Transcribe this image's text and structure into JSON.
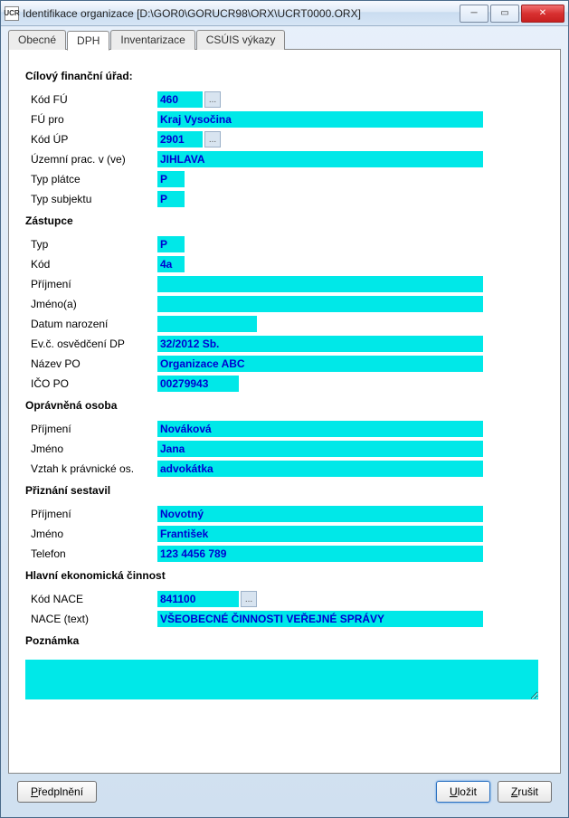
{
  "window": {
    "icon_text": "UCR",
    "title": "Identifikace organizace [D:\\GOR0\\GORUCR98\\ORX\\UCRT0000.ORX]"
  },
  "tabs": {
    "obecne": "Obecné",
    "dph": "DPH",
    "inventarizace": "Inventarizace",
    "csuis": "CSÚIS výkazy"
  },
  "sections": {
    "cilovy": "Cílový finanční úřad:",
    "zastupce": "Zástupce",
    "opravnena": "Oprávněná osoba",
    "priznani": "Přiznání sestavil",
    "hlavni": "Hlavní ekonomická činnost",
    "poznamka": "Poznámka"
  },
  "labels": {
    "kod_fu": "Kód FÚ",
    "fu_pro": "FÚ pro",
    "kod_up": "Kód ÚP",
    "uzemni": "Územní prac. v (ve)",
    "typ_platce": "Typ plátce",
    "typ_subjektu": "Typ subjektu",
    "z_typ": "Typ",
    "z_kod": "Kód",
    "z_prijmeni": "Příjmení",
    "z_jmenoa": "Jméno(a)",
    "z_datum": "Datum narození",
    "z_evc": "Ev.č. osvědčení DP",
    "z_nazev": "Název PO",
    "z_ico": "IČO PO",
    "o_prijmeni": "Příjmení",
    "o_jmeno": "Jméno",
    "o_vztah": "Vztah k právnické os.",
    "p_prijmeni": "Příjmení",
    "p_jmeno": "Jméno",
    "p_telefon": "Telefon",
    "kod_nace": "Kód NACE",
    "nace_text": "NACE (text)"
  },
  "values": {
    "kod_fu": "460",
    "fu_pro": "Kraj Vysočina",
    "kod_up": "2901",
    "uzemni": "JIHLAVA",
    "typ_platce": "P",
    "typ_subjektu": "P",
    "z_typ": "P",
    "z_kod": "4a",
    "z_prijmeni": "",
    "z_jmenoa": "",
    "z_datum": "",
    "z_evc": "32/2012 Sb.",
    "z_nazev": "Organizace ABC",
    "z_ico": "00279943",
    "o_prijmeni": "Nováková",
    "o_jmeno": "Jana",
    "o_vztah": "advokátka",
    "p_prijmeni": "Novotný",
    "p_jmeno": "František",
    "p_telefon": "123 4456 789",
    "kod_nace": "841100",
    "nace_text": "VŠEOBECNÉ ČINNOSTI VEŘEJNÉ SPRÁVY",
    "poznamka": ""
  },
  "buttons": {
    "predplneni": "Předplnění",
    "ulozit": "Uložit",
    "zrusit": "Zrušit",
    "ellipsis": "..."
  }
}
